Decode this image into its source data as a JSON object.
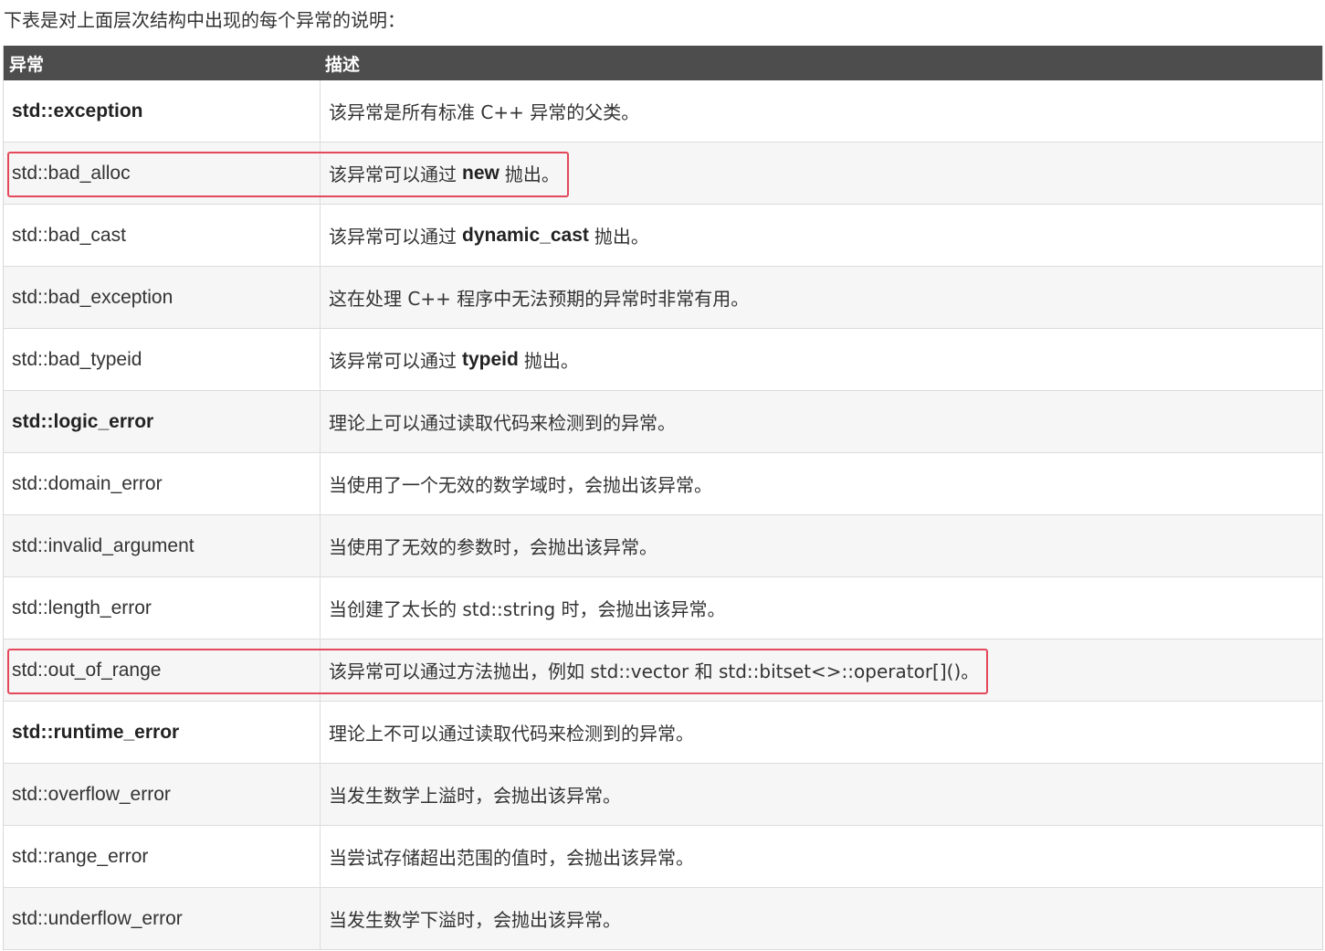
{
  "intro": "下表是对上面层次结构中出现的每个异常的说明：",
  "headers": {
    "exception": "异常",
    "description": "描述"
  },
  "rows": [
    {
      "name": "std::exception",
      "bold": true,
      "pre": "该异常是所有标准 C++ 异常的父类。",
      "kw": "",
      "post": "",
      "highlight": false
    },
    {
      "name": "std::bad_alloc",
      "bold": false,
      "pre": "该异常可以通过",
      "kw": "new",
      "post": "抛出。",
      "highlight": true
    },
    {
      "name": "std::bad_cast",
      "bold": false,
      "pre": "该异常可以通过",
      "kw": "dynamic_cast",
      "post": "抛出。",
      "highlight": false
    },
    {
      "name": "std::bad_exception",
      "bold": false,
      "pre": "这在处理 C++ 程序中无法预期的异常时非常有用。",
      "kw": "",
      "post": "",
      "highlight": false
    },
    {
      "name": "std::bad_typeid",
      "bold": false,
      "pre": "该异常可以通过",
      "kw": "typeid",
      "post": "抛出。",
      "highlight": false
    },
    {
      "name": "std::logic_error",
      "bold": true,
      "pre": "理论上可以通过读取代码来检测到的异常。",
      "kw": "",
      "post": "",
      "highlight": false
    },
    {
      "name": "std::domain_error",
      "bold": false,
      "pre": "当使用了一个无效的数学域时，会抛出该异常。",
      "kw": "",
      "post": "",
      "highlight": false
    },
    {
      "name": "std::invalid_argument",
      "bold": false,
      "pre": "当使用了无效的参数时，会抛出该异常。",
      "kw": "",
      "post": "",
      "highlight": false
    },
    {
      "name": "std::length_error",
      "bold": false,
      "pre": "当创建了太长的 std::string 时，会抛出该异常。",
      "kw": "",
      "post": "",
      "highlight": false
    },
    {
      "name": "std::out_of_range",
      "bold": false,
      "pre": "该异常可以通过方法抛出，例如 std::vector 和 std::bitset<>::operator[]()。",
      "kw": "",
      "post": "",
      "highlight": true
    },
    {
      "name": "std::runtime_error",
      "bold": true,
      "pre": "理论上不可以通过读取代码来检测到的异常。",
      "kw": "",
      "post": "",
      "highlight": false
    },
    {
      "name": "std::overflow_error",
      "bold": false,
      "pre": "当发生数学上溢时，会抛出该异常。",
      "kw": "",
      "post": "",
      "highlight": false
    },
    {
      "name": "std::range_error",
      "bold": false,
      "pre": "当尝试存储超出范围的值时，会抛出该异常。",
      "kw": "",
      "post": "",
      "highlight": false
    },
    {
      "name": "std::underflow_error",
      "bold": false,
      "pre": "当发生数学下溢时，会抛出该异常。",
      "kw": "",
      "post": "",
      "highlight": false
    }
  ],
  "colors": {
    "header_bg": "#4d4d4d",
    "highlight_border": "#e3495a",
    "stripe": "#f6f6f6"
  }
}
